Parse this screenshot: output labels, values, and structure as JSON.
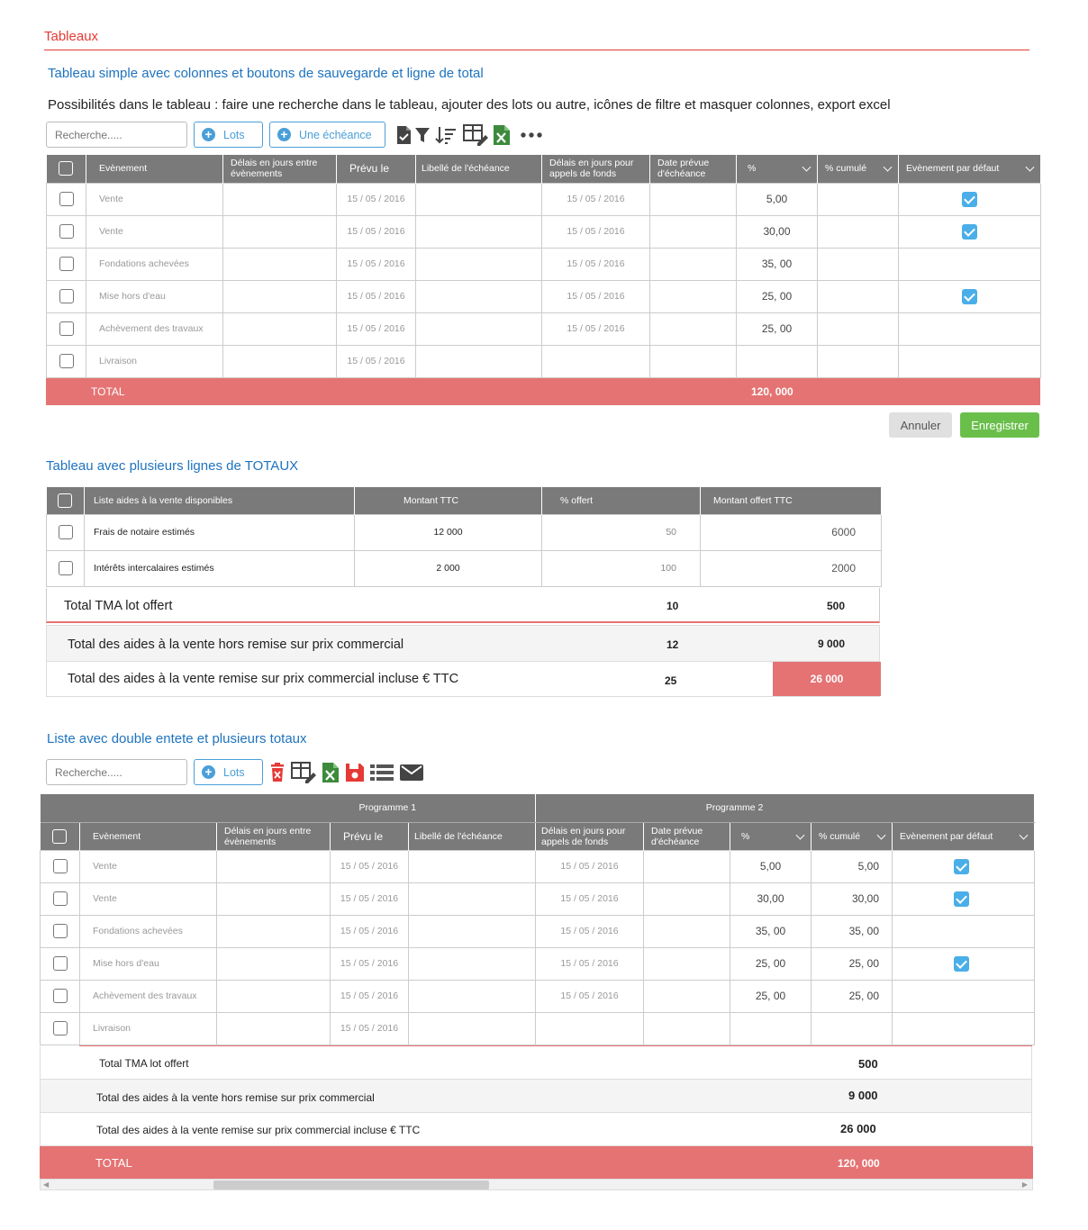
{
  "section_title": "Tableaux",
  "t1": {
    "title": "Tableau simple avec colonnes et boutons de sauvegarde et ligne de total",
    "description": "Possibilités dans le tableau : faire une recherche dans le tableau, ajouter des lots ou autre, icônes de filtre et masquer colonnes, export excel",
    "search_placeholder": "Recherche.....",
    "btn_lots": "Lots",
    "btn_echeance": "Une échéance",
    "headers": {
      "evenement": "Evènement",
      "delais": "Délais en jours entre évènements",
      "prevu": "Prévu le",
      "libelle": "Libellé de l'échéance",
      "delais_appels": "Délais en jours pour appels de fonds",
      "date_prevue": "Date prévue d'échéance",
      "pct": "%",
      "pct_cumule": "% cumulé",
      "evt_defaut": "Evènement par défaut"
    },
    "rows": [
      {
        "evenement": "Vente",
        "prevu": "15 / 05 / 2016",
        "appels": "15 / 05 / 2016",
        "pct": "5,00",
        "defaut": true
      },
      {
        "evenement": "Vente",
        "prevu": "15 / 05 / 2016",
        "appels": "15 / 05 / 2016",
        "pct": "30,00",
        "defaut": true
      },
      {
        "evenement": "Fondations achevées",
        "prevu": "15 / 05 / 2016",
        "appels": "15 / 05 / 2016",
        "pct": "35, 00",
        "defaut": false
      },
      {
        "evenement": "Mise hors d'eau",
        "prevu": "15 / 05 / 2016",
        "appels": "15 / 05 / 2016",
        "pct": "25, 00",
        "defaut": true
      },
      {
        "evenement": "Achèvement des travaux",
        "prevu": "15 / 05 / 2016",
        "appels": "15 / 05 / 2016",
        "pct": "25, 00",
        "defaut": false
      },
      {
        "evenement": "Livraison",
        "prevu": "15 / 05 / 2016",
        "appels": "",
        "pct": "",
        "defaut": false
      }
    ],
    "total_label": "TOTAL",
    "total_value": "120, 000",
    "btn_annuler": "Annuler",
    "btn_enregistrer": "Enregistrer"
  },
  "t2": {
    "title": "Tableau avec plusieurs lignes de TOTAUX",
    "headers": {
      "liste": "Liste aides à la vente disponibles",
      "montant": "Montant TTC",
      "offert": "% offert",
      "montant_offert": "Montant offert TTC"
    },
    "rows": [
      {
        "label": "Frais de notaire estimés",
        "montant": "12 000",
        "offert": "50",
        "montant_offert": "6000"
      },
      {
        "label": "Intérêts intercalaires estimés",
        "montant": "2 000",
        "offert": "100",
        "montant_offert": "2000"
      }
    ],
    "totals": [
      {
        "label": "Total TMA lot offert",
        "pct": "10",
        "value": "500"
      },
      {
        "label": "Total des aides à la vente hors remise sur prix commercial",
        "pct": "12",
        "value": "9 000"
      },
      {
        "label": "Total des  aides à la vente remise sur prix commercial incluse € TTC",
        "pct": "25",
        "value": "26 000"
      }
    ]
  },
  "t3": {
    "title": "Liste avec double entete et plusieurs totaux",
    "search_placeholder": "Recherche.....",
    "btn_lots": "Lots",
    "group1": "Programme 1",
    "group2": "Programme 2",
    "headers": {
      "evenement": "Evènement",
      "delais": "Délais en jours entre évènements",
      "prevu": "Prévu le",
      "libelle": "Libellé de l'échéance",
      "delais_appels": "Délais en jours pour appels de fonds",
      "date_prevue": "Date prévue d'échéance",
      "pct": "%",
      "pct_cumule": "% cumulé",
      "evt_defaut": "Evènement par défaut"
    },
    "rows": [
      {
        "evenement": "Vente",
        "prevu": "15 / 05 / 2016",
        "appels": "15 / 05 / 2016",
        "pct": "5,00",
        "cumule": "5,00",
        "defaut": true
      },
      {
        "evenement": "Vente",
        "prevu": "15 / 05 / 2016",
        "appels": "15 / 05 / 2016",
        "pct": "30,00",
        "cumule": "30,00",
        "defaut": true
      },
      {
        "evenement": "Fondations achevées",
        "prevu": "15 / 05 / 2016",
        "appels": "15 / 05 / 2016",
        "pct": "35, 00",
        "cumule": "35, 00",
        "defaut": false
      },
      {
        "evenement": "Mise hors d'eau",
        "prevu": "15 / 05 / 2016",
        "appels": "15 / 05 / 2016",
        "pct": "25, 00",
        "cumule": "25, 00",
        "defaut": true
      },
      {
        "evenement": "Achèvement des travaux",
        "prevu": "15 / 05 / 2016",
        "appels": "15 / 05 / 2016",
        "pct": "25, 00",
        "cumule": "25, 00",
        "defaut": false
      },
      {
        "evenement": "Livraison",
        "prevu": "15 / 05 / 2016",
        "appels": "",
        "pct": "",
        "cumule": "",
        "defaut": false
      }
    ],
    "totals": [
      {
        "label": "Total TMA lot offert",
        "value": "500"
      },
      {
        "label": "Total des aides à la vente hors remise sur prix commercial",
        "value": "9 000"
      },
      {
        "label": "Total des  aides à la vente remise sur prix commercial incluse € TTC",
        "value": "26 000"
      }
    ],
    "total_label": "TOTAL",
    "total_value": "120, 000"
  },
  "colors": {
    "accent": "#e53935",
    "link": "#1e73be",
    "header": "#7a7a7a",
    "total": "#e57373",
    "check": "#4aaee8",
    "save": "#6abf4b"
  }
}
